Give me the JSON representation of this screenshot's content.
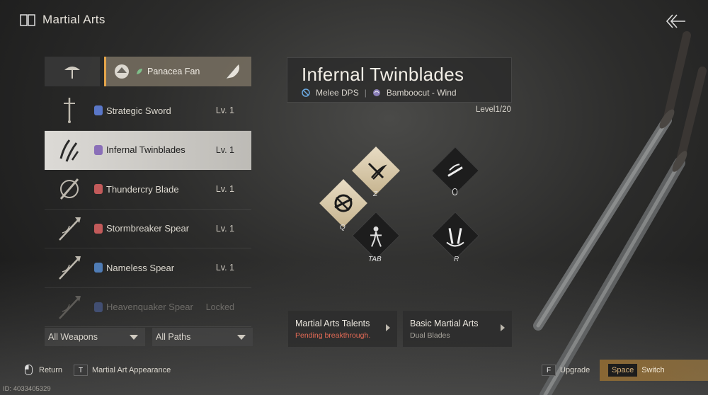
{
  "header": {
    "title": "Martial Arts"
  },
  "panacea": {
    "label": "Panacea Fan"
  },
  "weapons": [
    {
      "name": "Strategic Sword",
      "level": "Lv. 1",
      "icon": "sword-icon",
      "badge": "#5a77c8",
      "state": "normal"
    },
    {
      "name": "Infernal Twinblades",
      "level": "Lv. 1",
      "icon": "twinblades-icon",
      "badge": "#8a6fb8",
      "state": "active"
    },
    {
      "name": "Thundercry Blade",
      "level": "Lv. 1",
      "icon": "blade-icon",
      "badge": "#c25a5a",
      "state": "normal"
    },
    {
      "name": "Stormbreaker Spear",
      "level": "Lv. 1",
      "icon": "spear-icon",
      "badge": "#c25a5a",
      "state": "normal"
    },
    {
      "name": "Nameless Spear",
      "level": "Lv. 1",
      "icon": "spear-icon",
      "badge": "#4f7cb5",
      "state": "normal"
    },
    {
      "name": "Heavenquaker Spear",
      "level": "Locked",
      "icon": "spear-icon",
      "badge": "#5a77c8",
      "state": "locked"
    }
  ],
  "filters": {
    "weapons": "All Weapons",
    "paths": "All Paths"
  },
  "info": {
    "title": "Infernal Twinblades",
    "role": "Melee DPS",
    "path": "Bamboocut - Wind",
    "level": "Level1/20"
  },
  "skills": {
    "q": "Q",
    "z": "Z",
    "tab": "TAB",
    "r": "R"
  },
  "cards": {
    "talents": {
      "title": "Martial Arts Talents",
      "sub": "Pending breakthrough."
    },
    "basic": {
      "title": "Basic Martial Arts",
      "sub": "Dual Blades"
    }
  },
  "footer": {
    "return": "Return",
    "appearance_key": "T",
    "appearance": "Martial Art Appearance",
    "upgrade_key": "F",
    "upgrade": "Upgrade",
    "switch_key": "Space",
    "switch": "Switch"
  },
  "id_text": "ID: 4033405329",
  "colors": {
    "accent": "#e3a44a",
    "pending": "#e36a55"
  }
}
